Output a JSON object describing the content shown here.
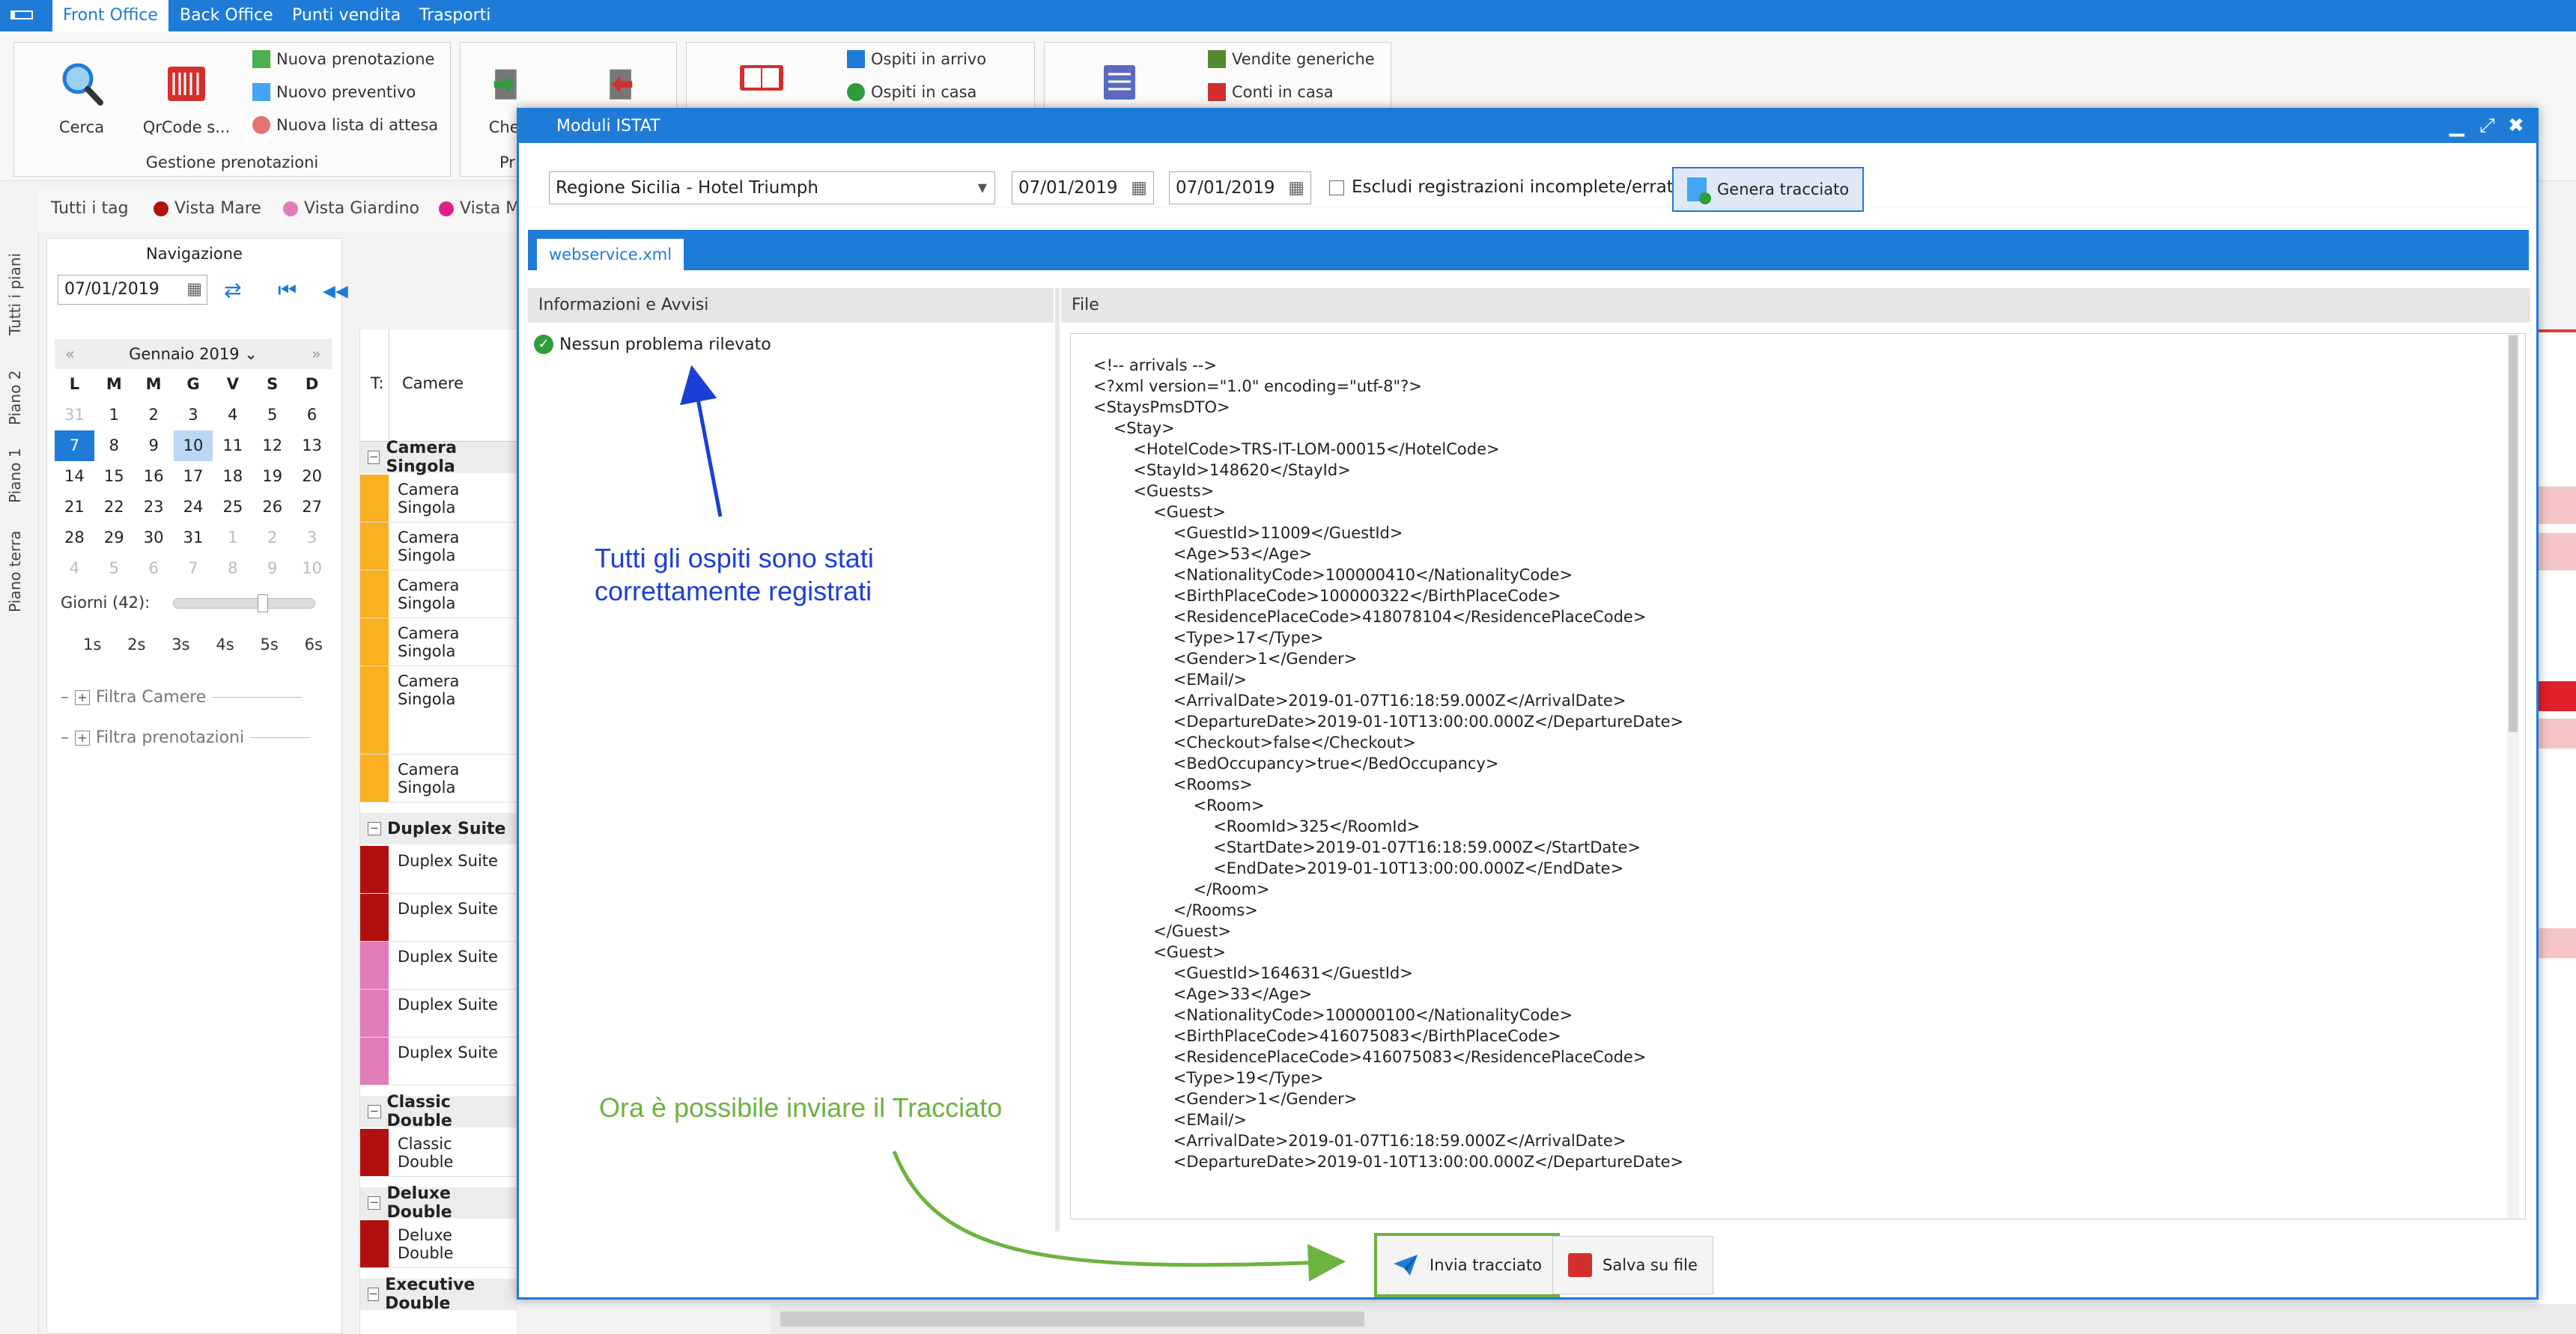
{
  "menubar": {
    "items": [
      {
        "label": "Front Office",
        "active": true
      },
      {
        "label": "Back Office",
        "active": false
      },
      {
        "label": "Punti vendita",
        "active": false
      },
      {
        "label": "Trasporti",
        "active": false
      }
    ]
  },
  "ribbon": {
    "search_label": "Cerca",
    "qrcode_label": "QrCode s...",
    "new_booking": "Nuova prenotazione",
    "new_quote": "Nuovo preventivo",
    "new_waitlist": "Nuova lista di attesa",
    "group1_label": "Gestione prenotazioni",
    "checkin_label": "Chec",
    "group2_label": "Pr",
    "guests_arriving": "Ospiti in arrivo",
    "guests_in_house": "Ospiti in casa",
    "generic_sales": "Vendite generiche",
    "house_accounts": "Conti in casa"
  },
  "tags": {
    "all": "Tutti i tag",
    "items": [
      {
        "label": "Vista Mare",
        "color": "#b01010"
      },
      {
        "label": "Vista Giardino",
        "color": "#e07db8"
      },
      {
        "label": "Vista M",
        "color": "#e0208a"
      }
    ]
  },
  "sidetabs": [
    "Tutti i piani",
    "Piano 2",
    "Piano 1",
    "Piano terra"
  ],
  "navigation": {
    "title": "Navigazione",
    "date": "07/01/2019",
    "month": "Gennaio 2019",
    "weekdays": [
      "L",
      "M",
      "M",
      "G",
      "V",
      "S",
      "D"
    ],
    "days": [
      [
        "31",
        "1",
        "2",
        "3",
        "4",
        "5",
        "6"
      ],
      [
        "7",
        "8",
        "9",
        "10",
        "11",
        "12",
        "13"
      ],
      [
        "14",
        "15",
        "16",
        "17",
        "18",
        "19",
        "20"
      ],
      [
        "21",
        "22",
        "23",
        "24",
        "25",
        "26",
        "27"
      ],
      [
        "28",
        "29",
        "30",
        "31",
        "1",
        "2",
        "3"
      ],
      [
        "4",
        "5",
        "6",
        "7",
        "8",
        "9",
        "10"
      ]
    ],
    "days_label": "Giorni (42):",
    "scale": [
      "1s",
      "2s",
      "3s",
      "4s",
      "5s",
      "6s"
    ],
    "filter_rooms": "Filtra Camere",
    "filter_bookings": "Filtra prenotazioni"
  },
  "grid": {
    "col_t": "T:",
    "col_rooms": "Camere",
    "groups": [
      {
        "name": "Camera Singola",
        "rows": [
          {
            "label": "Camera Singola",
            "color": "#f9b021"
          },
          {
            "label": "Camera Singola",
            "color": "#f9b021"
          },
          {
            "label": "Camera Singola",
            "color": "#f9b021"
          },
          {
            "label": "Camera Singola",
            "color": "#f9b021"
          },
          {
            "label": "Camera Singola",
            "color": "#f9b021"
          },
          {
            "label": "Camera Singola",
            "color": "#f9b021"
          }
        ]
      },
      {
        "name": "Duplex Suite",
        "rows": [
          {
            "label": "Duplex Suite",
            "color": "#b01010"
          },
          {
            "label": "Duplex Suite",
            "color": "#b01010"
          },
          {
            "label": "Duplex Suite",
            "color": "#e07db8"
          },
          {
            "label": "Duplex Suite",
            "color": "#e07db8"
          },
          {
            "label": "Duplex Suite",
            "color": "#e07db8"
          }
        ]
      },
      {
        "name": "Classic Double",
        "rows": [
          {
            "label": "Classic Double",
            "color": "#b01010"
          }
        ]
      },
      {
        "name": "Deluxe Double",
        "rows": [
          {
            "label": "Deluxe Double",
            "color": "#b01010"
          }
        ]
      },
      {
        "name": "Executive Double",
        "rows": []
      }
    ]
  },
  "modal": {
    "title": "Moduli ISTAT",
    "region_select": "Regione Sicilia - Hotel Triumph",
    "date_from": "07/01/2019",
    "date_to": "07/01/2019",
    "exclude_label": "Escludi registrazioni incomplete/errate",
    "generate_label": "Genera tracciato",
    "tab_label": "webservice.xml",
    "info_header": "Informazioni e Avvisi",
    "info_message": "Nessun problema rilevato",
    "file_header": "File",
    "xml": "<!-- arrivals -->\n<?xml version=\"1.0\" encoding=\"utf-8\"?>\n<StaysPmsDTO>\n    <Stay>\n        <HotelCode>TRS-IT-LOM-00015</HotelCode>\n        <StayId>148620</StayId>\n        <Guests>\n            <Guest>\n                <GuestId>11009</GuestId>\n                <Age>53</Age>\n                <NationalityCode>100000410</NationalityCode>\n                <BirthPlaceCode>100000322</BirthPlaceCode>\n                <ResidencePlaceCode>418078104</ResidencePlaceCode>\n                <Type>17</Type>\n                <Gender>1</Gender>\n                <EMail/>\n                <ArrivalDate>2019-01-07T16:18:59.000Z</ArrivalDate>\n                <DepartureDate>2019-01-10T13:00:00.000Z</DepartureDate>\n                <Checkout>false</Checkout>\n                <BedOccupancy>true</BedOccupancy>\n                <Rooms>\n                    <Room>\n                        <RoomId>325</RoomId>\n                        <StartDate>2019-01-07T16:18:59.000Z</StartDate>\n                        <EndDate>2019-01-10T13:00:00.000Z</EndDate>\n                    </Room>\n                </Rooms>\n            </Guest>\n            <Guest>\n                <GuestId>164631</GuestId>\n                <Age>33</Age>\n                <NationalityCode>100000100</NationalityCode>\n                <BirthPlaceCode>416075083</BirthPlaceCode>\n                <ResidencePlaceCode>416075083</ResidencePlaceCode>\n                <Type>19</Type>\n                <Gender>1</Gender>\n                <EMail/>\n                <ArrivalDate>2019-01-07T16:18:59.000Z</ArrivalDate>\n                <DepartureDate>2019-01-10T13:00:00.000Z</DepartureDate>",
    "send_label": "Invia tracciato",
    "save_label": "Salva su file"
  },
  "annotations": {
    "blue_text": "Tutti gli ospiti sono stati\ncorrettamente registrati",
    "green_text": "Ora è possibile inviare il Tracciato",
    "blue_color": "#1b3fd6",
    "green_color": "#6cb33f"
  }
}
